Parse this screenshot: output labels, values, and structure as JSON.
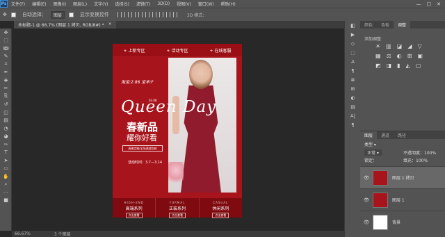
{
  "app": {
    "logo": "Ps"
  },
  "menu": [
    "文件(F)",
    "编辑(E)",
    "图像(I)",
    "图层(L)",
    "文字(Y)",
    "选择(S)",
    "滤镜(T)",
    "3D(D)",
    "视图(V)",
    "窗口(W)",
    "帮助(H)"
  ],
  "window_controls": [
    "—",
    "□",
    "✕"
  ],
  "options": {
    "auto_select_label": "自动选择：",
    "auto_select_value": "图层",
    "show_transform_label": "显示变换控件",
    "mode3d_label": "3D 模式："
  },
  "document_tab": {
    "title": "未标题-1 @ 66.7% (图层 1 拷贝, RGB/8#) *",
    "close": "×"
  },
  "tools": [
    "move-icon",
    "marquee-icon",
    "lasso-icon",
    "quick-select-icon",
    "crop-icon",
    "eyedropper-icon",
    "healing-icon",
    "brush-icon",
    "stamp-icon",
    "history-brush-icon",
    "eraser-icon",
    "gradient-icon",
    "blur-icon",
    "dodge-icon",
    "pen-icon",
    "text-icon",
    "path-select-icon",
    "shape-icon",
    "hand-icon",
    "zoom-icon",
    "more-icon",
    "colors-icon"
  ],
  "tool_glyphs": [
    "✥",
    "⬚",
    "ↂ",
    "✎",
    "⌗",
    "✒",
    "✚",
    "✏",
    "⎘",
    "↺",
    "◫",
    "▤",
    "◔",
    "◕",
    "✑",
    "T",
    "➤",
    "▭",
    "✋",
    "⌕",
    "⋯",
    "■"
  ],
  "poster": {
    "nav": [
      "+ 上新专区",
      "+ 活动专区",
      "+ 在线客服"
    ],
    "tmall": "淘宝:2.86 宝丰:F",
    "date": "03.08",
    "queen": "Queen Day",
    "spring": "春新品",
    "subtitle": "耀你好看",
    "custom": "高端定制/全场满减包邮",
    "event": "活动时间：3.7—3.14",
    "categories": [
      {
        "en": "HIGH-END",
        "cn": "高端系列",
        "btn": "点击查看"
      },
      {
        "en": "FORMAL",
        "cn": "正装系列",
        "btn": "点击查看"
      },
      {
        "en": "CASUAL",
        "cn": "休闲系列",
        "btn": "点击查看"
      }
    ]
  },
  "status": {
    "zoom": "66.67%",
    "info": "3 个图层"
  },
  "panel_tabs_top": [
    "颜色",
    "色板",
    "调整"
  ],
  "adjust_title": "添加调整",
  "adjust_rows": [
    [
      "☀",
      "▥",
      "◪",
      "◢",
      "▽"
    ],
    [
      "▦",
      "⚖",
      "◐",
      "⊞",
      "▣"
    ],
    [
      "◩",
      "◨",
      "▮",
      "◭",
      "▢"
    ]
  ],
  "side_icons": [
    "◧",
    "▶",
    "◇",
    "⬚",
    "A",
    "¶",
    "≣",
    "⊞",
    "◐",
    "▤",
    "A|",
    "¶"
  ],
  "layers_tabs": [
    "图层",
    "通道",
    "路径"
  ],
  "layers": {
    "kind": "类型",
    "blend": "正常",
    "opacity_label": "不透明度：",
    "opacity": "100%",
    "lock_label": "锁定：",
    "fill_label": "填充：",
    "fill": "100%",
    "rows": [
      {
        "name": "图层 1 拷贝"
      },
      {
        "name": "图层 1"
      },
      {
        "name": "背景"
      }
    ],
    "eye": "👁"
  }
}
